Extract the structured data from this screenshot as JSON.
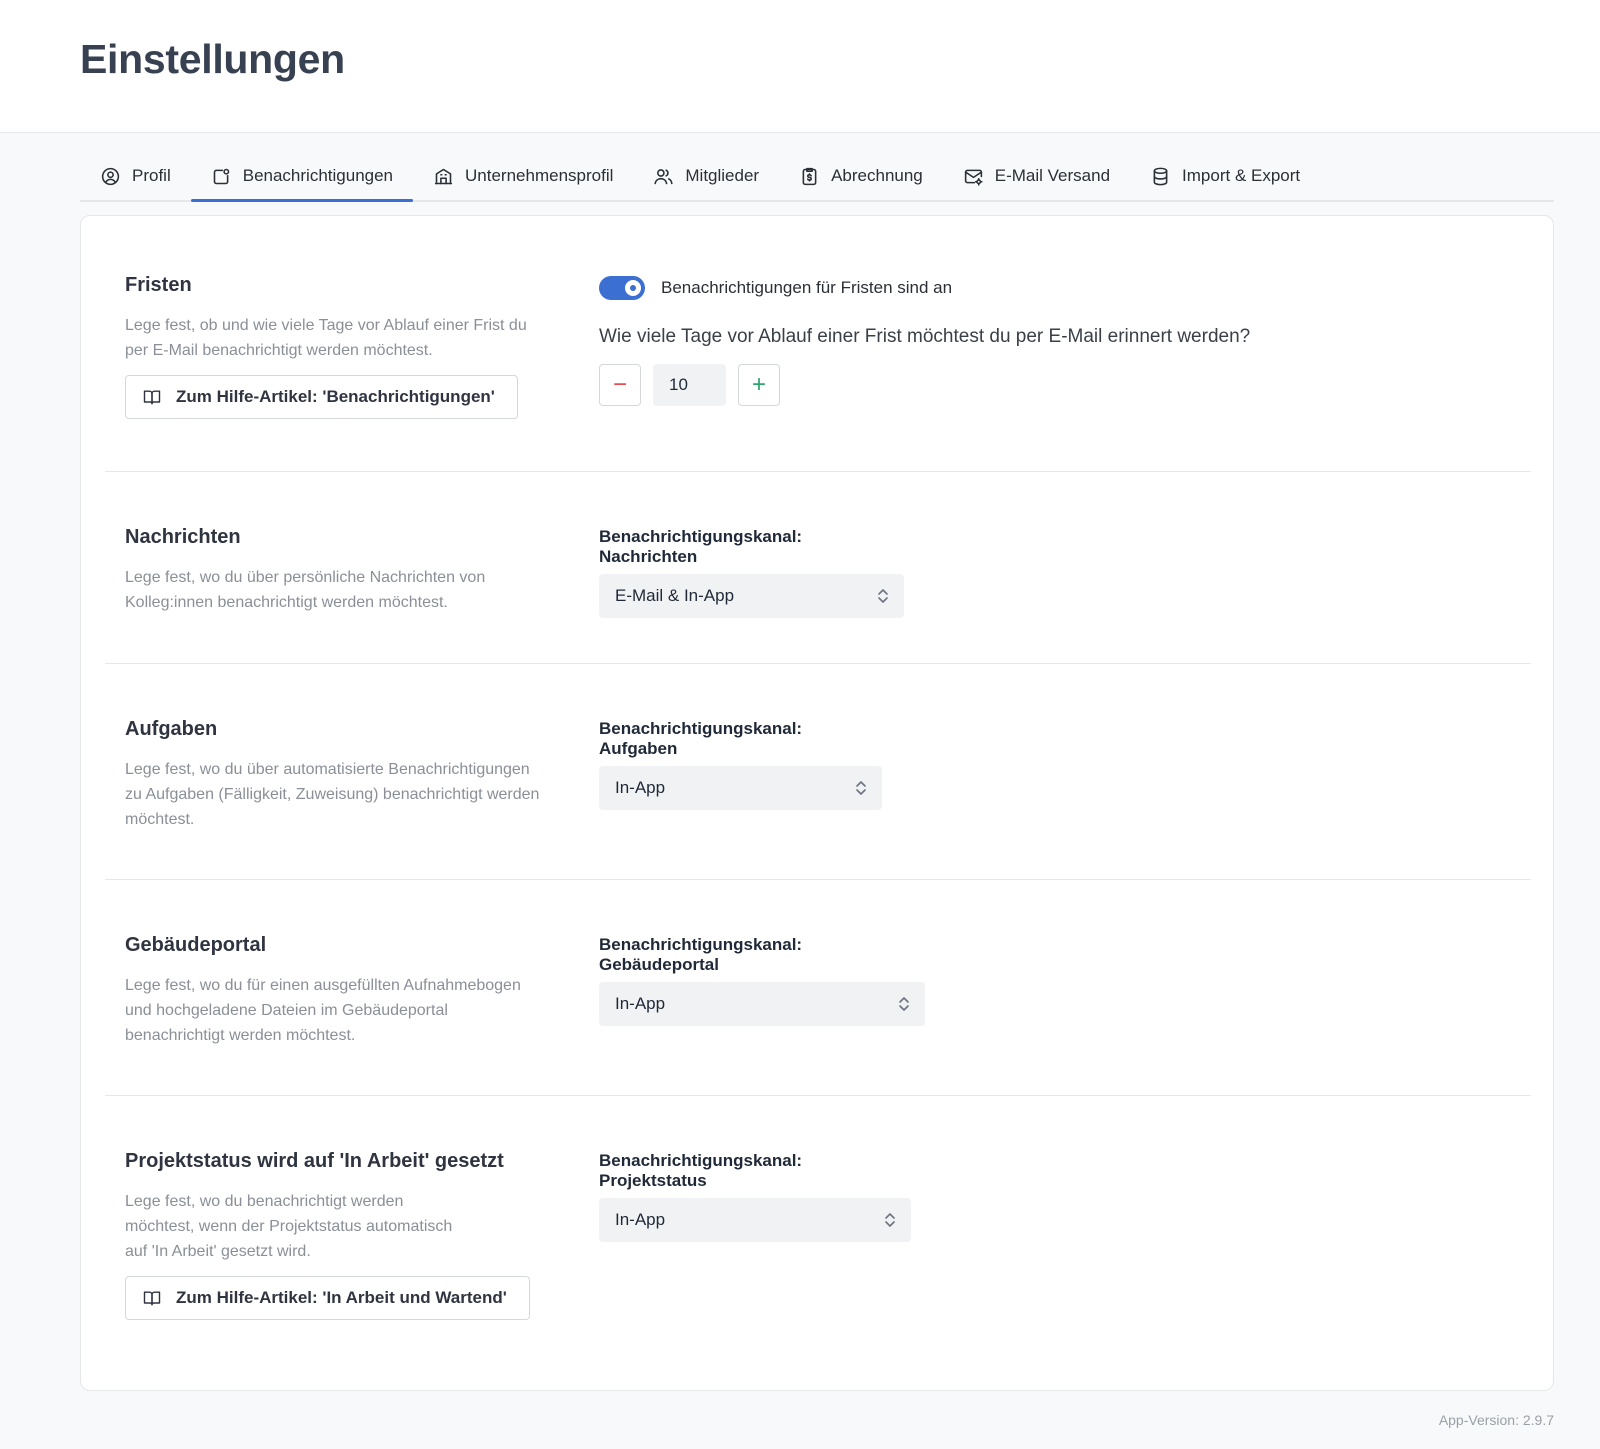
{
  "page": {
    "title": "Einstellungen",
    "version": "App-Version: 2.9.7"
  },
  "tabs": [
    {
      "label": "Profil",
      "icon": "user-circle-icon"
    },
    {
      "label": "Benachrichtigungen",
      "icon": "notification-icon",
      "active": true
    },
    {
      "label": "Unternehmensprofil",
      "icon": "building-icon"
    },
    {
      "label": "Mitglieder",
      "icon": "users-icon"
    },
    {
      "label": "Abrechnung",
      "icon": "billing-icon"
    },
    {
      "label": "E-Mail Versand",
      "icon": "mail-settings-icon"
    },
    {
      "label": "Import & Export",
      "icon": "database-icon"
    }
  ],
  "sections": {
    "fristen": {
      "title": "Fristen",
      "description": "Lege fest, ob und wie viele Tage vor Ablauf einer Frist du per E-Mail benachrichtigt werden möchtest.",
      "help_label": "Zum Hilfe-Artikel: 'Benachrichtigungen'",
      "toggle_label": "Benachrichtigungen für Fristen sind an",
      "toggle_on": true,
      "question": "Wie viele Tage vor Ablauf einer Frist möchtest du per E-Mail erinnert werden?",
      "days": "10",
      "minus": "−",
      "plus": "+"
    },
    "nachrichten": {
      "title": "Nachrichten",
      "description": "Lege fest, wo du über persönliche Nachrichten von Kolleg:innen benachrichtigt werden möchtest.",
      "field_label": "Benachrichtigungskanal: Nachrichten",
      "value": "E-Mail & In-App"
    },
    "aufgaben": {
      "title": "Aufgaben",
      "description": "Lege fest, wo du über automatisierte Benachrichtigungen zu Aufgaben (Fälligkeit, Zuweisung) benachrichtigt werden möchtest.",
      "field_label": "Benachrichtigungskanal: Aufgaben",
      "value": "In-App"
    },
    "gebaeudeportal": {
      "title": "Gebäudeportal",
      "description": "Lege fest, wo du für einen ausgefüllten Aufnahmebogen und hochgeladene Dateien im Gebäudeportal benachrichtigt werden möchtest.",
      "field_label": "Benachrichtigungskanal: Gebäudeportal",
      "value": "In-App"
    },
    "projektstatus": {
      "title": "Projektstatus wird auf 'In Arbeit' gesetzt",
      "description": "Lege fest, wo du benachrichtigt werden möchtest, wenn der Projektstatus automatisch auf 'In Arbeit' gesetzt wird.",
      "help_label": "Zum Hilfe-Artikel: 'In Arbeit und Wartend'",
      "field_label": "Benachrichtigungskanal: Projektstatus",
      "value": "In-App"
    }
  },
  "colors": {
    "accent": "#3b6fd1",
    "minus": "#e5484d",
    "plus": "#30a46c"
  }
}
